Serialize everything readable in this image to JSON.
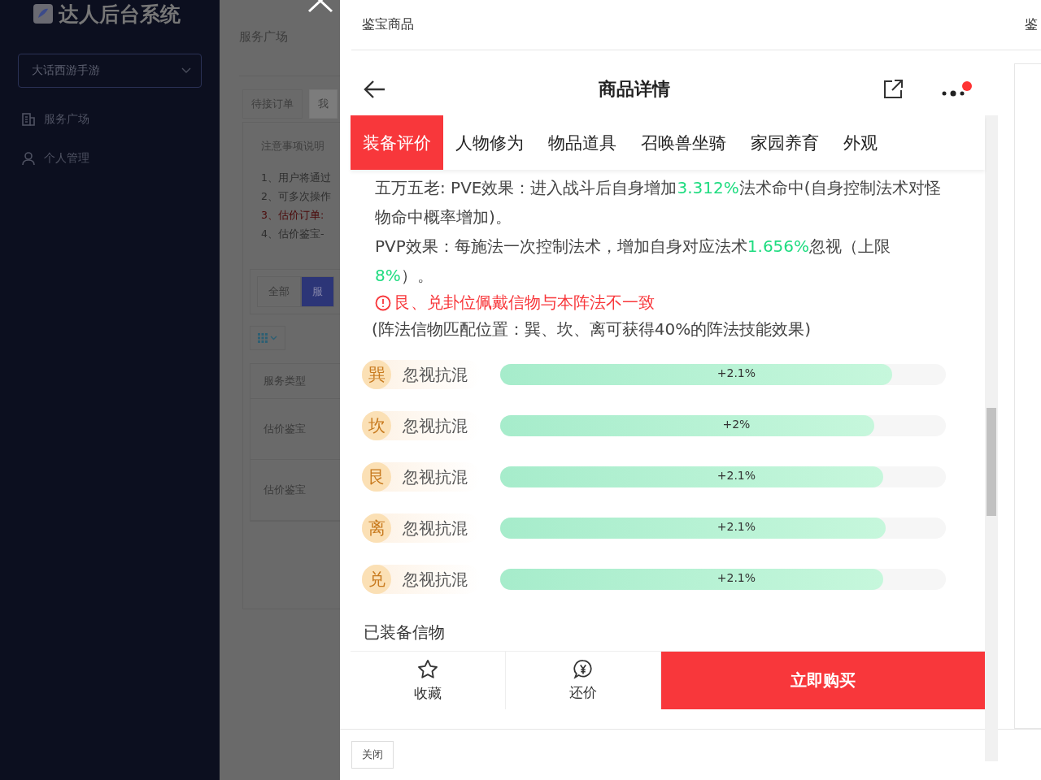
{
  "sidebar": {
    "logo": "达人后台系统",
    "game_select": "大话西游手游",
    "menu": [
      {
        "label": "服务广场"
      },
      {
        "label": "个人管理"
      }
    ]
  },
  "background_page": {
    "title": "服务广场",
    "tabs": [
      {
        "label": "待接订单",
        "selected": false
      },
      {
        "label": "我",
        "selected": true
      }
    ],
    "notice_title": "注意事项说明",
    "notices": [
      {
        "text": "1、用户将通过",
        "warning": false
      },
      {
        "text": "2、可多次操作",
        "warning": false
      },
      {
        "text": "3、估价订单:",
        "warning": true
      },
      {
        "text": "4、估价鉴宝-",
        "warning": false
      }
    ],
    "filters": [
      {
        "label": "全部",
        "selected": false
      },
      {
        "label": "服",
        "selected": true
      }
    ],
    "table": {
      "columns": [
        "服务类型"
      ],
      "rows": [
        "估价鉴宝",
        "估价鉴宝"
      ]
    }
  },
  "drawer": {
    "title": "鉴宝商品",
    "next_title": "鉴",
    "close_button": "关闭",
    "phone": {
      "title": "商品详情",
      "has_notification": true,
      "tabs": [
        {
          "label": "装备评价",
          "selected": true
        },
        {
          "label": "人物修为",
          "selected": false
        },
        {
          "label": "物品道具",
          "selected": false
        },
        {
          "label": "召唤兽坐骑",
          "selected": false
        },
        {
          "label": "家园养育",
          "selected": false
        },
        {
          "label": "外观",
          "selected": false
        }
      ],
      "paragraphs": [
        [
          {
            "text": "五万五老: PVE效果：进入战斗后自身增加",
            "highlight": false
          },
          {
            "text": "3.312%",
            "highlight": true
          },
          {
            "text": "法术命中(自身控制法术对怪物命中概率增加)。",
            "highlight": false
          }
        ],
        [
          {
            "text": "PVP效果：每施法一次控制法术，增加自身对应法术",
            "highlight": false
          },
          {
            "text": "1.656%",
            "highlight": true
          },
          {
            "text": "忽视（上限",
            "highlight": false
          },
          {
            "text": "8%",
            "highlight": true
          },
          {
            "text": "）。",
            "highlight": false
          }
        ]
      ],
      "warning": "艮、兑卦位佩戴信物与本阵法不一致",
      "note": "(阵法信物匹配位置：巽、坎、离可获得40%的阵法技能效果)",
      "bars": [
        {
          "trigram": "巽",
          "label": "忽视抗混",
          "value": "+2.1%",
          "level": 0.88
        },
        {
          "trigram": "坎",
          "label": "忽视抗混",
          "value": "+2%",
          "level": 0.84
        },
        {
          "trigram": "艮",
          "label": "忽视抗混",
          "value": "+2.1%",
          "level": 0.86
        },
        {
          "trigram": "离",
          "label": "忽视抗混",
          "value": "+2.1%",
          "level": 0.865
        },
        {
          "trigram": "兑",
          "label": "忽视抗混",
          "value": "+2.1%",
          "level": 0.86
        }
      ],
      "section": "已装备信物",
      "actions": [
        {
          "label": "收藏"
        },
        {
          "label": "还价"
        }
      ],
      "buy_button": "立即购买"
    }
  }
}
